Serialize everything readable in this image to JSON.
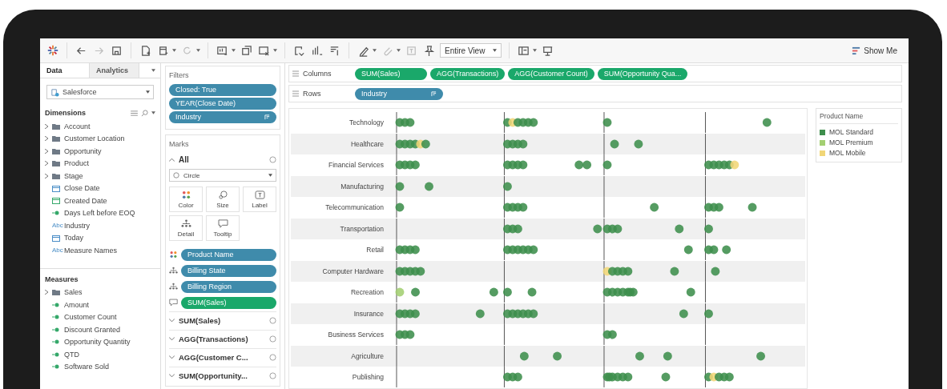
{
  "toolbar": {
    "view_mode": "Entire View",
    "show_me": "Show Me"
  },
  "data_pane": {
    "tabs": [
      {
        "label": "Data",
        "selected": true
      },
      {
        "label": "Analytics",
        "selected": false
      }
    ],
    "data_source": "Salesforce",
    "dimensions": {
      "title": "Dimensions",
      "items": [
        {
          "label": "Account",
          "kind": "folder"
        },
        {
          "label": "Customer Location",
          "kind": "folder"
        },
        {
          "label": "Opportunity",
          "kind": "folder"
        },
        {
          "label": "Product",
          "kind": "folder"
        },
        {
          "label": "Stage",
          "kind": "folder"
        },
        {
          "label": "Close Date",
          "kind": "date-discrete"
        },
        {
          "label": "Created Date",
          "kind": "date-continuous"
        },
        {
          "label": "Days Left before EOQ",
          "kind": "number"
        },
        {
          "label": "Industry",
          "kind": "text",
          "glyph": "Abc"
        },
        {
          "label": "Today",
          "kind": "date-discrete"
        },
        {
          "label": "Measure Names",
          "kind": "text",
          "glyph": "Abc"
        }
      ]
    },
    "measures": {
      "title": "Measures",
      "items": [
        {
          "label": "Sales",
          "kind": "folder"
        },
        {
          "label": "Amount",
          "kind": "number"
        },
        {
          "label": "Customer Count",
          "kind": "number"
        },
        {
          "label": "Discount Granted",
          "kind": "number"
        },
        {
          "label": "Opportunity Quantity",
          "kind": "number"
        },
        {
          "label": "QTD",
          "kind": "number"
        },
        {
          "label": "Software Sold",
          "kind": "number"
        }
      ]
    }
  },
  "filters": {
    "title": "Filters",
    "pills": [
      {
        "label": "Closed: True",
        "sorted": false
      },
      {
        "label": "YEAR(Close Date)",
        "sorted": false
      },
      {
        "label": "Industry",
        "sorted": true
      }
    ]
  },
  "marks": {
    "title": "Marks",
    "all_label": "All",
    "mark_type": "Circle",
    "buttons": [
      {
        "label": "Color",
        "kind": "color"
      },
      {
        "label": "Size",
        "kind": "size"
      },
      {
        "label": "Label",
        "kind": "label"
      },
      {
        "label": "Detail",
        "kind": "detail"
      },
      {
        "label": "Tooltip",
        "kind": "tooltip"
      }
    ],
    "fields": [
      {
        "label": "Product Name",
        "kind": "color-dimension"
      },
      {
        "label": "Billing State",
        "kind": "detail-dimension"
      },
      {
        "label": "Billing Region",
        "kind": "detail-dimension"
      },
      {
        "label": "SUM(Sales)",
        "kind": "tooltip-measure"
      }
    ],
    "cards": [
      "SUM(Sales)",
      "AGG(Transactions)",
      "AGG(Customer C...",
      "SUM(Opportunity..."
    ]
  },
  "columns_shelf": {
    "label": "Columns",
    "pills": [
      {
        "label": "SUM(Sales)",
        "kind": "measure",
        "sorted": false
      },
      {
        "label": "AGG(Transactions)",
        "kind": "measure",
        "sorted": false
      },
      {
        "label": "AGG(Customer Count)",
        "kind": "measure",
        "sorted": false
      },
      {
        "label": "SUM(Opportunity Qua...",
        "kind": "measure",
        "sorted": false
      }
    ]
  },
  "rows_shelf": {
    "label": "Rows",
    "pills": [
      {
        "label": "Industry",
        "kind": "dimension",
        "sorted": true
      }
    ]
  },
  "chart": {
    "rows": [
      "Technology",
      "Healthcare",
      "Financial Services",
      "Manufacturing",
      "Telecommunication",
      "Transportation",
      "Retail",
      "Computer Hardware",
      "Recreation",
      "Insurance",
      "Business Services",
      "Agriculture",
      "Publishing"
    ]
  },
  "legend": {
    "title": "Product Name",
    "items": [
      {
        "label": "MOL Standard",
        "color": "#3e8e4c"
      },
      {
        "label": "MOL Premium",
        "color": "#a3cf72"
      },
      {
        "label": "MOL Mobile",
        "color": "#f1d677"
      }
    ]
  }
}
